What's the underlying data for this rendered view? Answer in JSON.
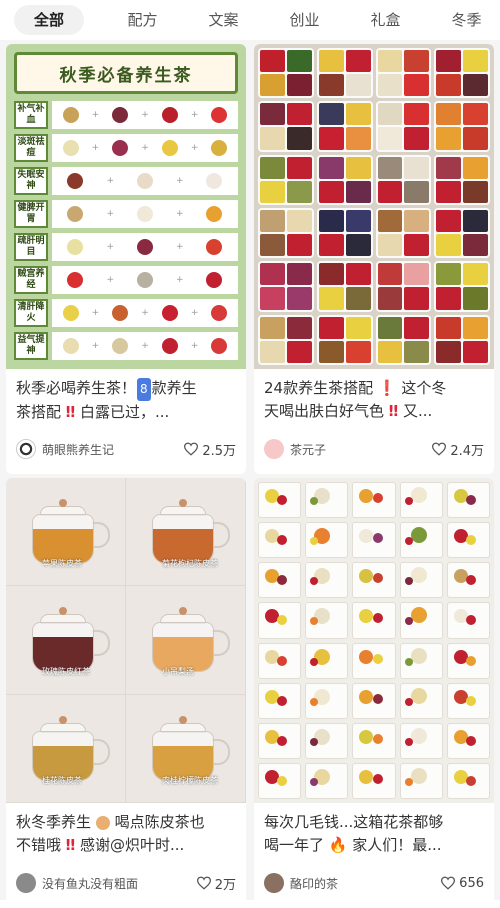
{
  "tabs": [
    "全部",
    "配方",
    "文案",
    "创业",
    "礼盒",
    "冬季"
  ],
  "active_tab": "全部",
  "colors": {
    "accent": "#222222",
    "tab_active_bg": "#f1f1f1",
    "feed_bg": "#f5f5f5"
  },
  "cards": [
    {
      "image": {
        "banner": "秋季必备养生茶",
        "rows": [
          "补气补血",
          "淡斑祛痘",
          "失眠安神",
          "健脾开胃",
          "疏肝明目",
          "贼宫养经",
          "清肝降火",
          "益气提神"
        ]
      },
      "title": "秋季必喝养生茶！🔢款养生茶搭配‼️ 白露已过，...",
      "title_line1": "秋季必喝养生茶！",
      "title_num": "8",
      "title_line1b": "款养生",
      "title_line2": "茶搭配",
      "title_line2b": "白露已过，...",
      "author": "萌眼熊养生记",
      "likes": "2.5万"
    },
    {
      "title_line1": "24款养生茶搭配",
      "title_line1b": "这个冬",
      "title_line2": "天喝出肤白好气色",
      "title_line2b": "又...",
      "author": "茶元子",
      "likes": "2.4万"
    },
    {
      "image": {
        "labels": [
          "苹果陈皮茶",
          "菊花枸杞陈皮茶",
          "玫瑰陈皮红茶",
          "小吊梨汤",
          "桂花陈皮茶",
          "肉桂柠檬陈皮茶"
        ]
      },
      "title_line1": "秋冬季养生",
      "title_line1b": "喝点陈皮茶也",
      "title_line2": "不错哦",
      "title_line2b": "感谢@炽叶时...",
      "author": "没有鱼丸没有粗面",
      "likes": "2万"
    },
    {
      "title_line1": "每次几毛钱...这箱花茶都够",
      "title_line2": "喝一年了",
      "title_line2b": "家人们！最...",
      "author": "酪印的茶",
      "likes": "656"
    }
  ],
  "icons": {
    "like": "heart-outline-icon"
  }
}
